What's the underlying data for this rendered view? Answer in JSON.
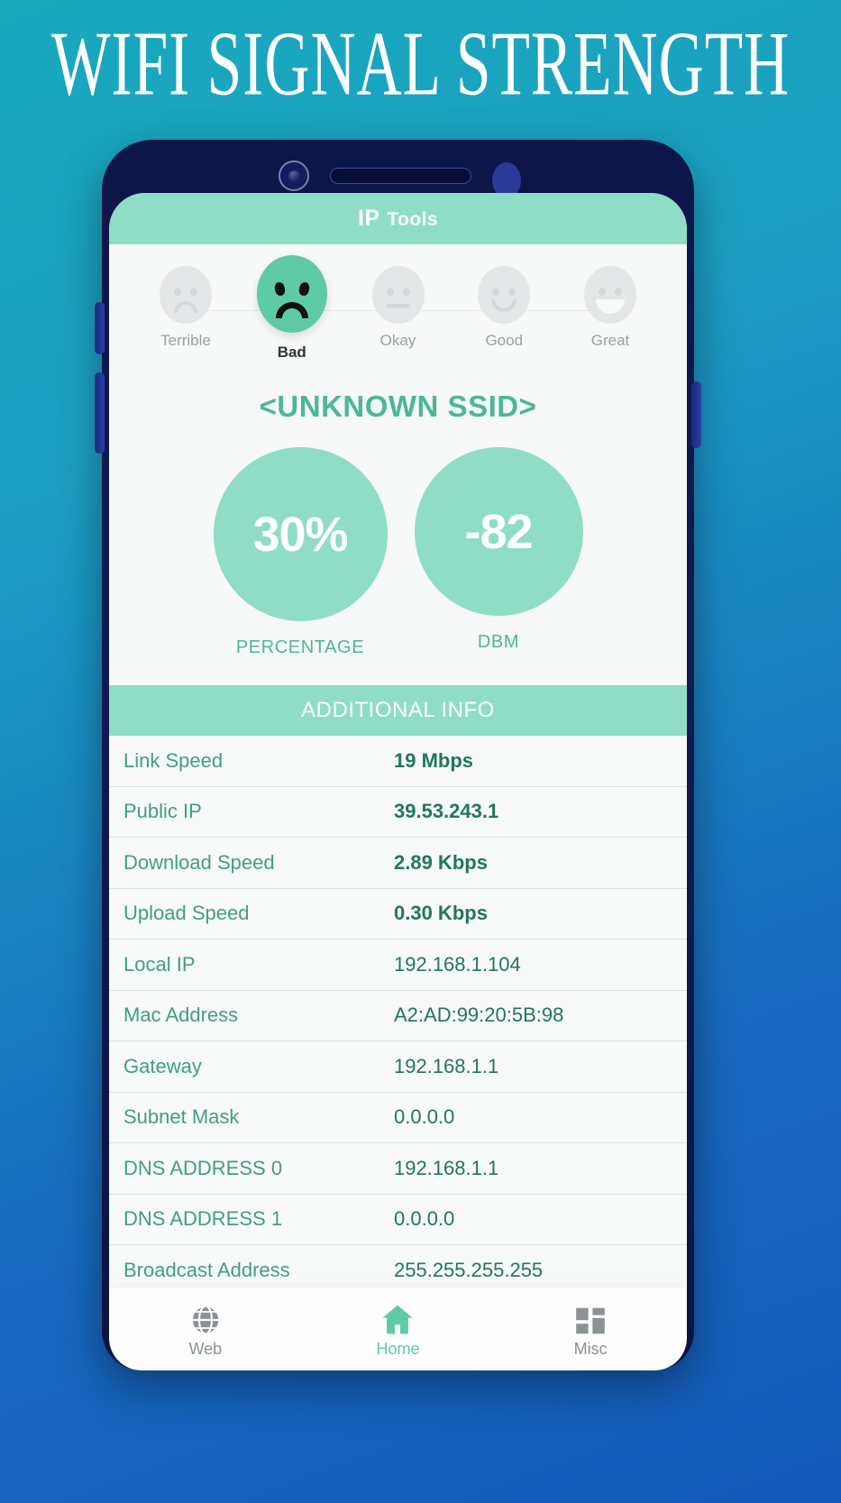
{
  "banner": {
    "title": "WIFI SIGNAL STRENGTH"
  },
  "app": {
    "title_main": "IP",
    "title_rest": "Tools"
  },
  "rating": {
    "items": [
      {
        "label": "Terrible",
        "face": "frown-icon",
        "active": false
      },
      {
        "label": "Bad",
        "face": "sad-face-icon",
        "active": true
      },
      {
        "label": "Okay",
        "face": "neutral-face-icon",
        "active": false
      },
      {
        "label": "Good",
        "face": "smile-icon",
        "active": false
      },
      {
        "label": "Great",
        "face": "grin-icon",
        "active": false
      }
    ]
  },
  "network": {
    "ssid": "<UNKNOWN SSID>",
    "percentage_value": "30%",
    "percentage_label": "PERCENTAGE",
    "dbm_value": "-82",
    "dbm_label": "DBM"
  },
  "additional_info": {
    "header": "ADDITIONAL INFO",
    "rows": [
      {
        "key": "Link Speed",
        "value": "19 Mbps",
        "bold": true
      },
      {
        "key": "Public IP",
        "value": "39.53.243.1",
        "bold": true
      },
      {
        "key": "Download Speed",
        "value": "2.89 Kbps",
        "bold": true
      },
      {
        "key": "Upload Speed",
        "value": "0.30 Kbps",
        "bold": true
      },
      {
        "key": "Local IP",
        "value": "192.168.1.104",
        "bold": false
      },
      {
        "key": "Mac Address",
        "value": "A2:AD:99:20:5B:98",
        "bold": false
      },
      {
        "key": "Gateway",
        "value": "192.168.1.1",
        "bold": false
      },
      {
        "key": "Subnet Mask",
        "value": "0.0.0.0",
        "bold": false
      },
      {
        "key": "DNS ADDRESS 0",
        "value": "192.168.1.1",
        "bold": false
      },
      {
        "key": "DNS ADDRESS 1",
        "value": "0.0.0.0",
        "bold": false
      },
      {
        "key": "Broadcast Address",
        "value": "255.255.255.255",
        "bold": false
      }
    ]
  },
  "navbar": {
    "items": [
      {
        "label": "Web",
        "icon": "globe-icon",
        "active": false
      },
      {
        "label": "Home",
        "icon": "home-icon",
        "active": true
      },
      {
        "label": "Misc",
        "icon": "grid-icon",
        "active": false
      }
    ]
  },
  "colors": {
    "accent_mint": "#8fddc6",
    "accent_green": "#5ecaa8",
    "text_teal": "#3f9f83",
    "value_teal": "#20775d",
    "phone_body": "#101a52"
  }
}
